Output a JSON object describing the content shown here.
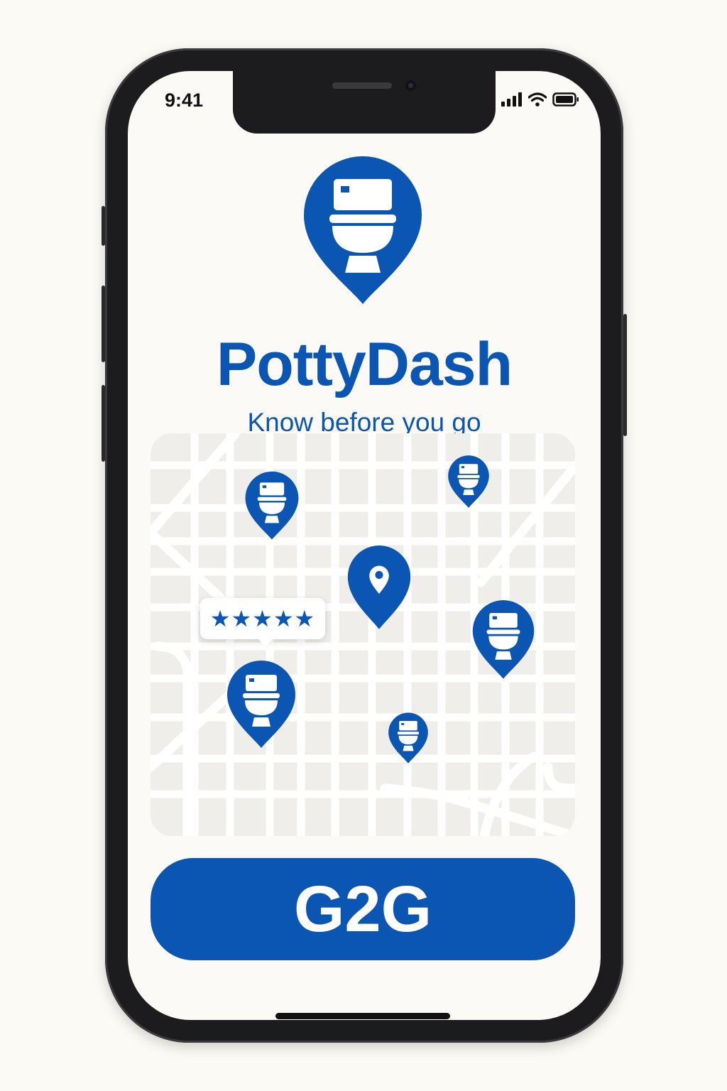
{
  "status_bar": {
    "time": "9:41",
    "icons": [
      "signal-icon",
      "wifi-icon",
      "battery-icon"
    ]
  },
  "app": {
    "name": "PottyDash",
    "tagline": "Know before you go",
    "logo_icon": "toilet-location-pin-icon"
  },
  "map": {
    "pins": [
      {
        "type": "toilet",
        "icon": "toilet-pin-icon"
      },
      {
        "type": "toilet",
        "icon": "toilet-pin-icon"
      },
      {
        "type": "current-location",
        "icon": "location-pin-icon"
      },
      {
        "type": "toilet",
        "icon": "toilet-pin-icon"
      },
      {
        "type": "toilet",
        "icon": "toilet-pin-icon"
      },
      {
        "type": "toilet",
        "icon": "toilet-pin-icon"
      }
    ],
    "rating": {
      "stars": 5,
      "max": 5,
      "display": "★★★★★"
    }
  },
  "cta": {
    "label": "G2G"
  },
  "colors": {
    "brand": "#0a56b2",
    "background": "#fbfaf6",
    "map": "#f0eeea",
    "frame": "#1c1c1e"
  }
}
